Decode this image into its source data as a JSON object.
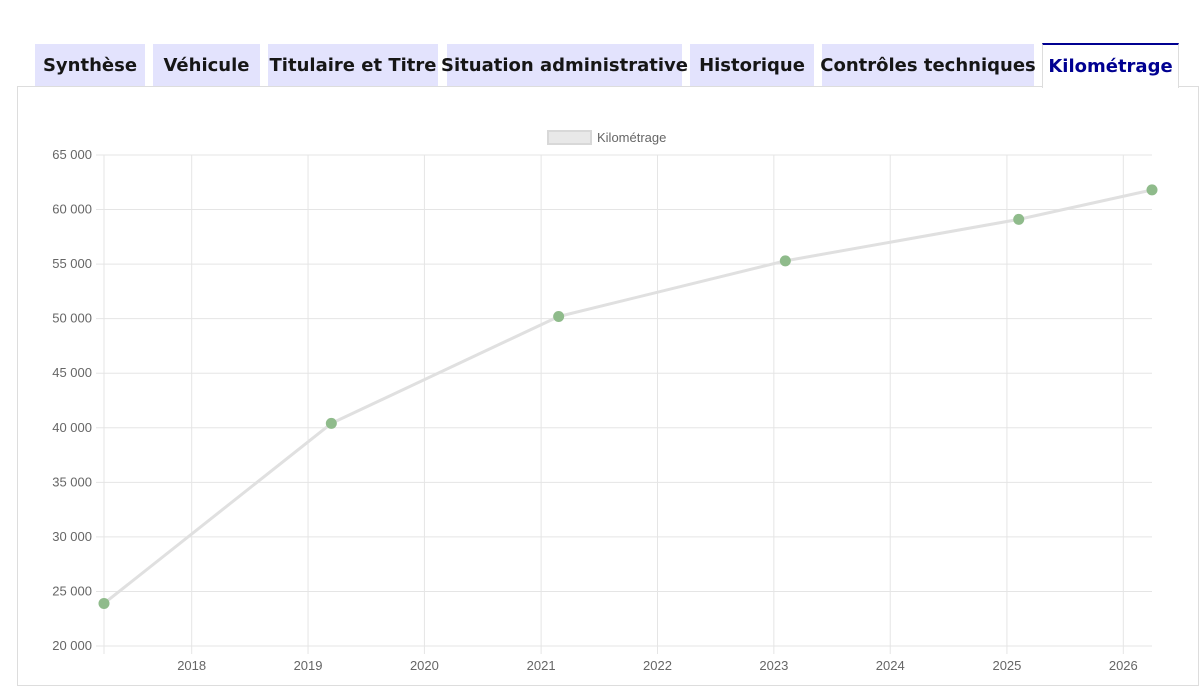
{
  "tabs": [
    {
      "label": "Synthèse",
      "active": false
    },
    {
      "label": "Véhicule",
      "active": false
    },
    {
      "label": "Titulaire et Titre",
      "active": false
    },
    {
      "label": "Situation administrative",
      "active": false
    },
    {
      "label": "Historique",
      "active": false
    },
    {
      "label": "Contrôles techniques",
      "active": false
    },
    {
      "label": "Kilométrage",
      "active": true
    }
  ],
  "colors": {
    "tab_bg": "#e3e3fd",
    "tab_active_text": "#000091",
    "line": "#e0e0e0",
    "point": "#8fbb8b",
    "grid": "#e5e5e5"
  },
  "chart_data": {
    "type": "line",
    "title": "",
    "xlabel": "",
    "ylabel": "",
    "legend": {
      "labels": [
        "Kilométrage"
      ],
      "position": "top"
    },
    "grid": true,
    "ylim": [
      20000,
      65000
    ],
    "yticks": [
      "20 000",
      "25 000",
      "30 000",
      "35 000",
      "40 000",
      "45 000",
      "50 000",
      "55 000",
      "60 000",
      "65 000"
    ],
    "xlim": [
      "2017-04-01",
      "2026-04-01"
    ],
    "xticks": [
      "2018",
      "2019",
      "2020",
      "2021",
      "2022",
      "2023",
      "2024",
      "2025",
      "2026"
    ],
    "series": [
      {
        "name": "Kilométrage",
        "points": [
          {
            "x": "2017-04-01",
            "y": 23900
          },
          {
            "x": "2019-03-15",
            "y": 40400
          },
          {
            "x": "2021-02-25",
            "y": 50200
          },
          {
            "x": "2023-02-06",
            "y": 55300
          },
          {
            "x": "2025-02-07",
            "y": 59100
          },
          {
            "x": "2026-04-01",
            "y": 61800
          }
        ]
      }
    ]
  }
}
